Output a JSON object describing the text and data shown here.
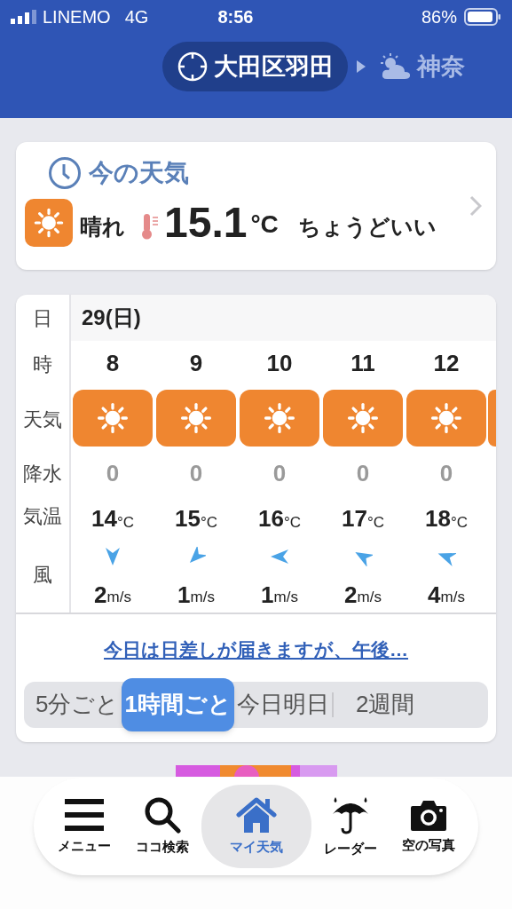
{
  "status_bar": {
    "carrier": "LINEMO",
    "network": "4G",
    "time": "8:56",
    "battery": "86%"
  },
  "locations": [
    {
      "name": "大田区羽田",
      "selected": true,
      "kind": "current"
    },
    {
      "name": "神奈",
      "selected": false,
      "kind": "weather"
    }
  ],
  "current_weather": {
    "title": "今の天気",
    "condition": "晴れ",
    "temperature": "15.1",
    "unit": "°C",
    "comment": "ちょうどいい"
  },
  "forecast": {
    "row_labels": [
      "日",
      "時",
      "天気",
      "降水",
      "気温",
      "風"
    ],
    "date": "29(日)",
    "hours": [
      {
        "hour": "8",
        "weather": {
          "kind": "sunny"
        },
        "precip": "0",
        "temp": "14",
        "temp_unit": "°C",
        "wind": {
          "kind": "n",
          "speed": "2",
          "unit": "m/s"
        }
      },
      {
        "hour": "9",
        "weather": {
          "kind": "sunny"
        },
        "precip": "0",
        "temp": "15",
        "temp_unit": "°C",
        "wind": {
          "kind": "ne",
          "speed": "1",
          "unit": "m/s"
        }
      },
      {
        "hour": "10",
        "weather": {
          "kind": "sunny"
        },
        "precip": "0",
        "temp": "16",
        "temp_unit": "°C",
        "wind": {
          "kind": "e",
          "speed": "1",
          "unit": "m/s"
        }
      },
      {
        "hour": "11",
        "weather": {
          "kind": "sunny"
        },
        "precip": "0",
        "temp": "17",
        "temp_unit": "°C",
        "wind": {
          "kind": "se",
          "speed": "2",
          "unit": "m/s"
        }
      },
      {
        "hour": "12",
        "weather": {
          "kind": "sunny"
        },
        "precip": "0",
        "temp": "18",
        "temp_unit": "°C",
        "wind": {
          "kind": "ese",
          "speed": "4",
          "unit": "m/s"
        }
      }
    ],
    "summary_link": "今日は日差しが届きますが、午後…",
    "tabs": [
      {
        "label": "5分ごと",
        "selected": false
      },
      {
        "label": "1時間ごと",
        "selected": true
      },
      {
        "label": "今日明日",
        "selected": false
      },
      {
        "label": "2週間",
        "selected": false
      }
    ]
  },
  "nav": [
    {
      "label": "メニュー",
      "kind": "menu",
      "selected": false
    },
    {
      "label": "ココ検索",
      "kind": "search",
      "selected": false
    },
    {
      "label": "マイ天気",
      "kind": "home",
      "selected": true
    },
    {
      "label": "レーダー",
      "kind": "radar",
      "selected": false
    },
    {
      "label": "空の写真",
      "kind": "camera",
      "selected": false
    }
  ]
}
